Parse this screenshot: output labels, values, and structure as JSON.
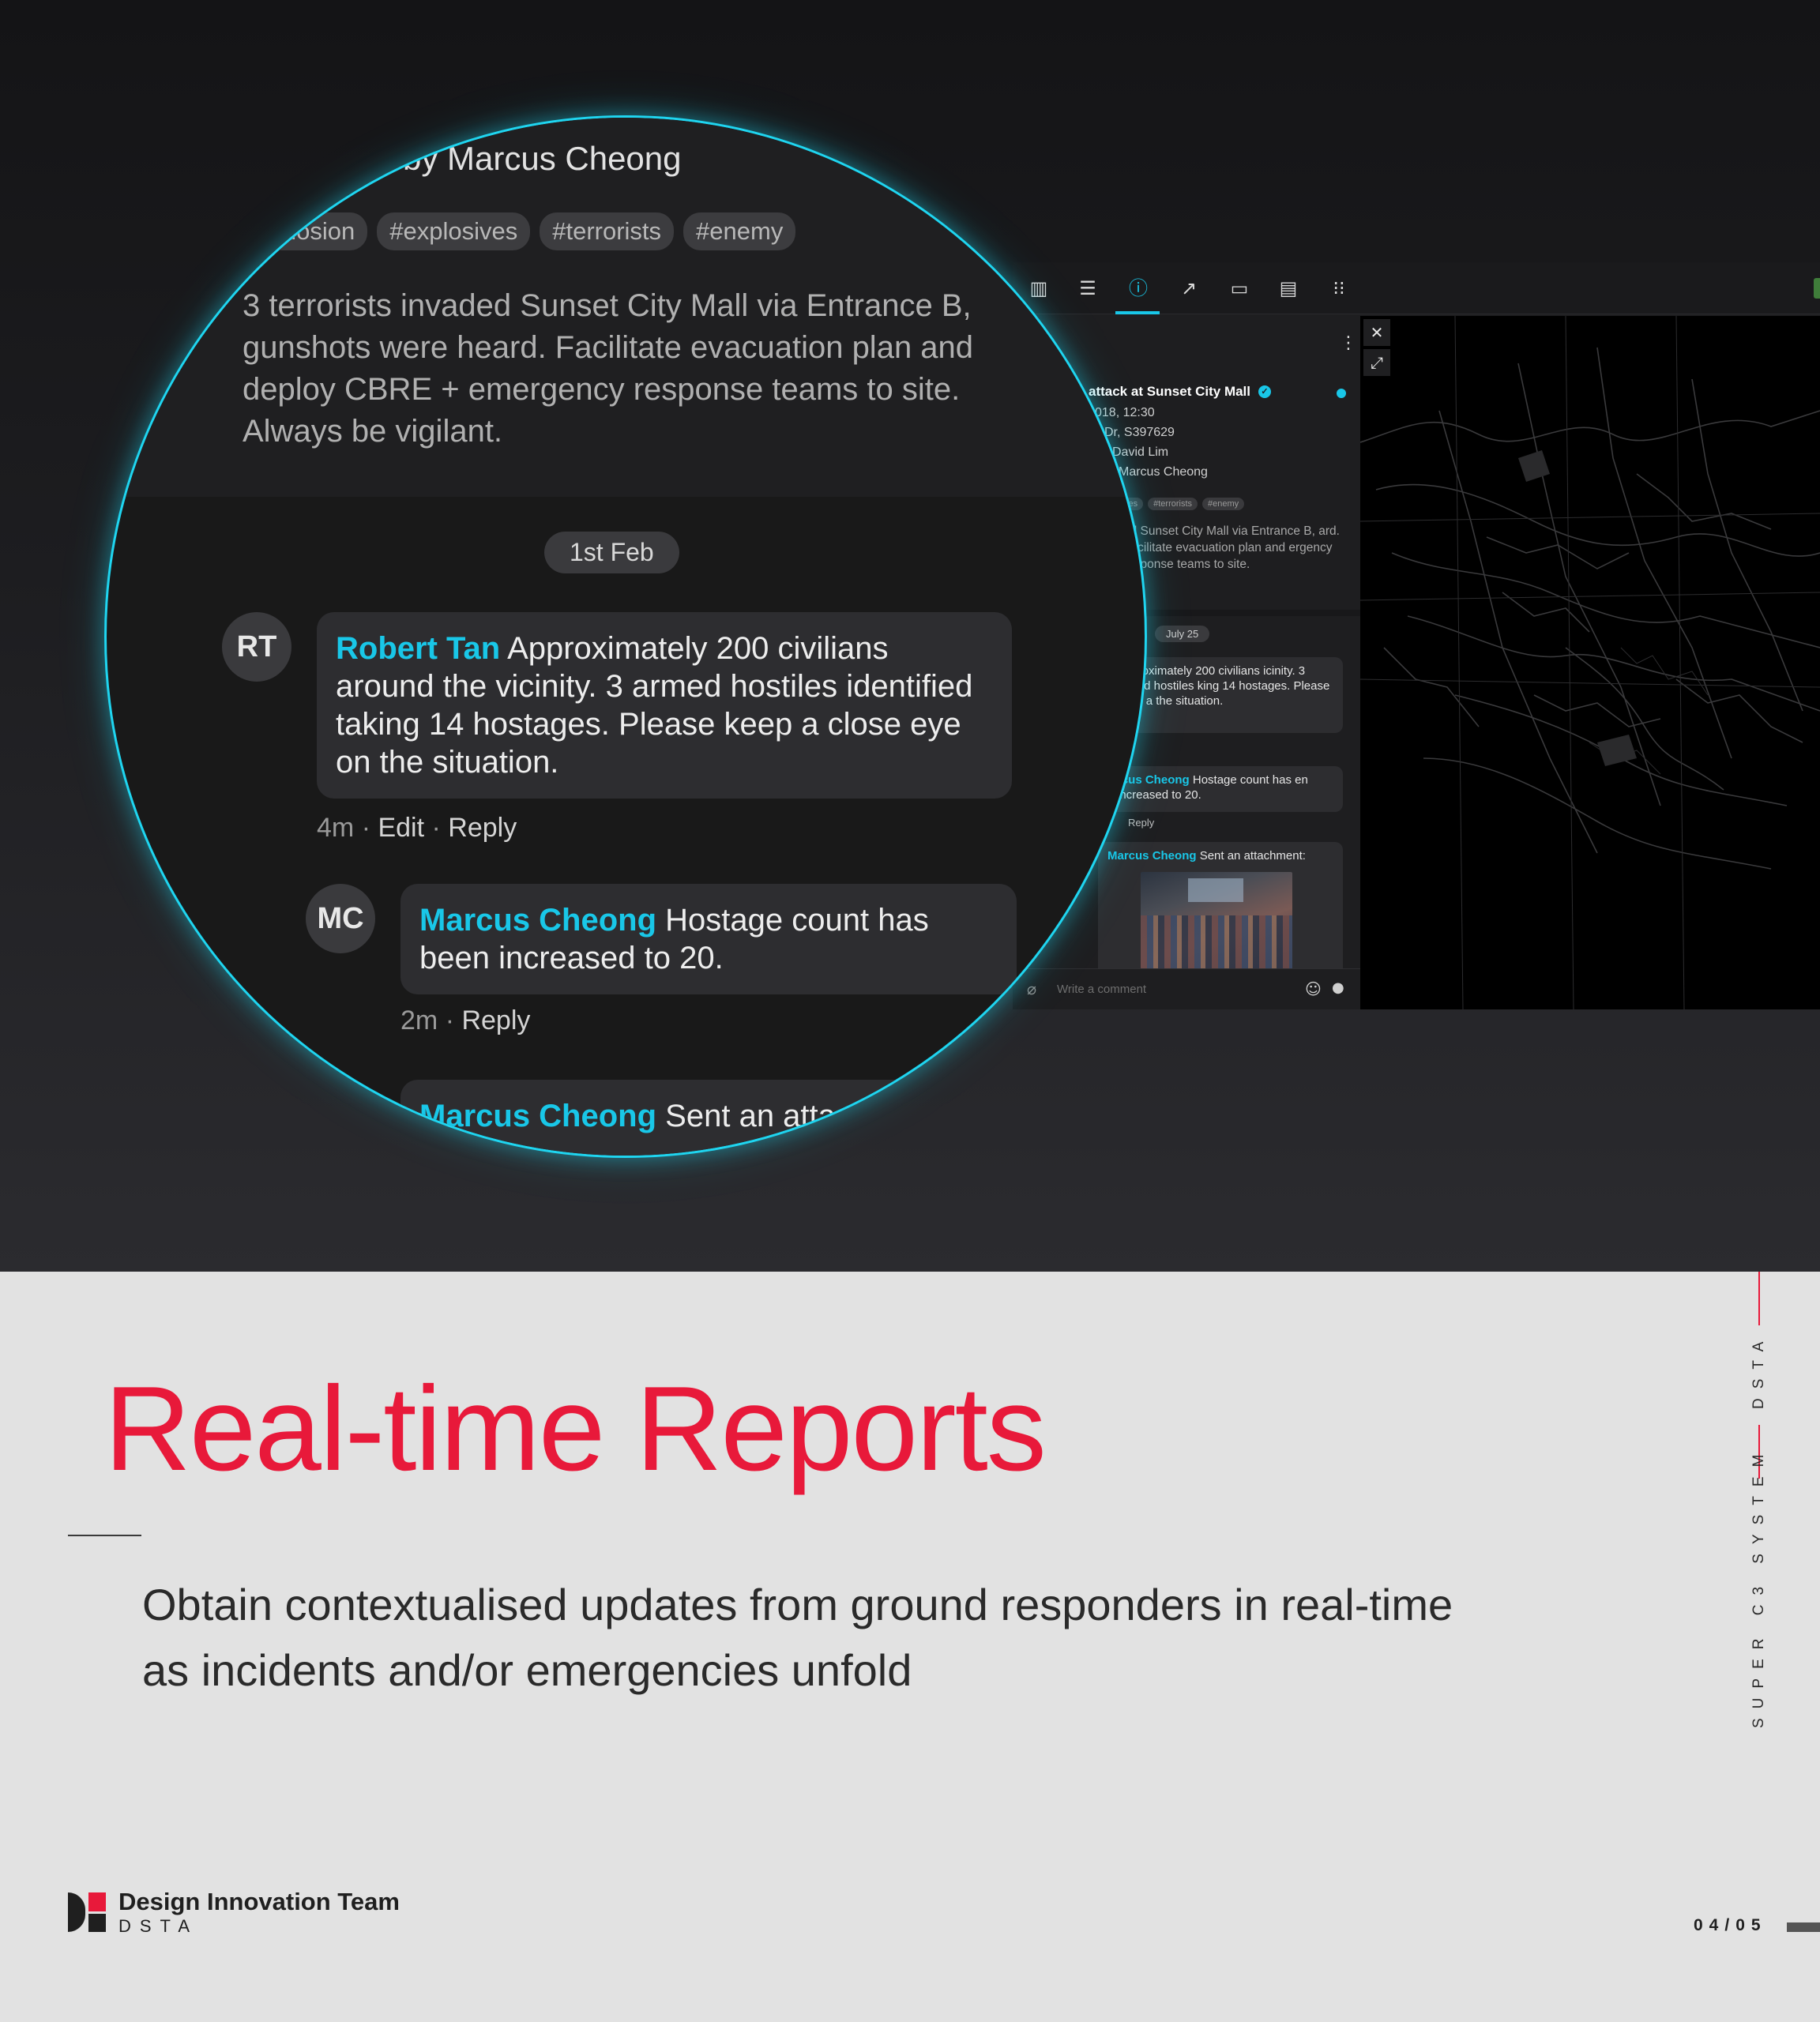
{
  "colors": {
    "accent": "#19c7e8",
    "brand_red": "#e8193a",
    "dark_bg": "#1e1e20"
  },
  "app": {
    "toolbar_icons": [
      "bar-chart-icon",
      "list-icon",
      "alert-icon",
      "trend-icon",
      "clipboard-icon",
      "chat-icon",
      "grid-icon"
    ],
    "active_tab": "alert-icon",
    "panel": {
      "back_label": "k",
      "title": "attack at Sunset City Mall",
      "meta": [
        "018, 12:30",
        "Dr, S397629",
        "David Lim",
        "Marcus Cheong"
      ],
      "tags": [
        "ves",
        "#terrorists",
        "#enemy"
      ],
      "description": "ed Sunset City Mall via Entrance B, ard. Facilitate evacuation plan and ergency response teams to site.",
      "date_chip": "July 25",
      "comments": [
        {
          "name": "",
          "text": "Approximately 200 civilians icinity. 3 armed hostiles king 14 hostages. Please keep a the situation.",
          "reply": "eply"
        },
        {
          "name": "rcus Cheong",
          "text": "Hostage count has en increased to 20.",
          "reply": "Reply"
        },
        {
          "name": "Marcus Cheong",
          "text": "Sent an attachment:"
        }
      ],
      "comment_placeholder": "Write a comment"
    }
  },
  "lens": {
    "byline": "by Marcus Cheong",
    "tags": [
      "plosion",
      "#explosives",
      "#terrorists",
      "#enemy"
    ],
    "description": "3 terrorists invaded Sunset City Mall via Entrance B, gunshots were heard. Facilitate evacuation plan and deploy CBRE + emergency response teams to site. Always be vigilant.",
    "date_chip": "1st Feb",
    "comment1": {
      "initials": "RT",
      "name": "Robert Tan",
      "text": "Approximately 200 civilians around the vicinity. 3 armed hostiles identified taking 14 hostages. Please keep a close eye on the situation.",
      "time": "4m",
      "edit": "Edit",
      "reply": "Reply"
    },
    "comment2": {
      "initials": "MC",
      "name": "Marcus Cheong",
      "text": "Hostage count has been increased to 20.",
      "time": "2m",
      "reply": "Reply"
    },
    "comment3": {
      "name": "Marcus Cheong",
      "text": "Sent an atta"
    }
  },
  "slide": {
    "heading": "Real-time Reports",
    "subtitle": "Obtain contextualised updates from ground responders in real-time as incidents and/or emergencies unfold",
    "side_brand": "DSTA",
    "side_system": "SUPER C3 SYSTEM",
    "team_name": "Design Innovation Team",
    "team_org": "DSTA",
    "page_indicator": "04/05"
  }
}
